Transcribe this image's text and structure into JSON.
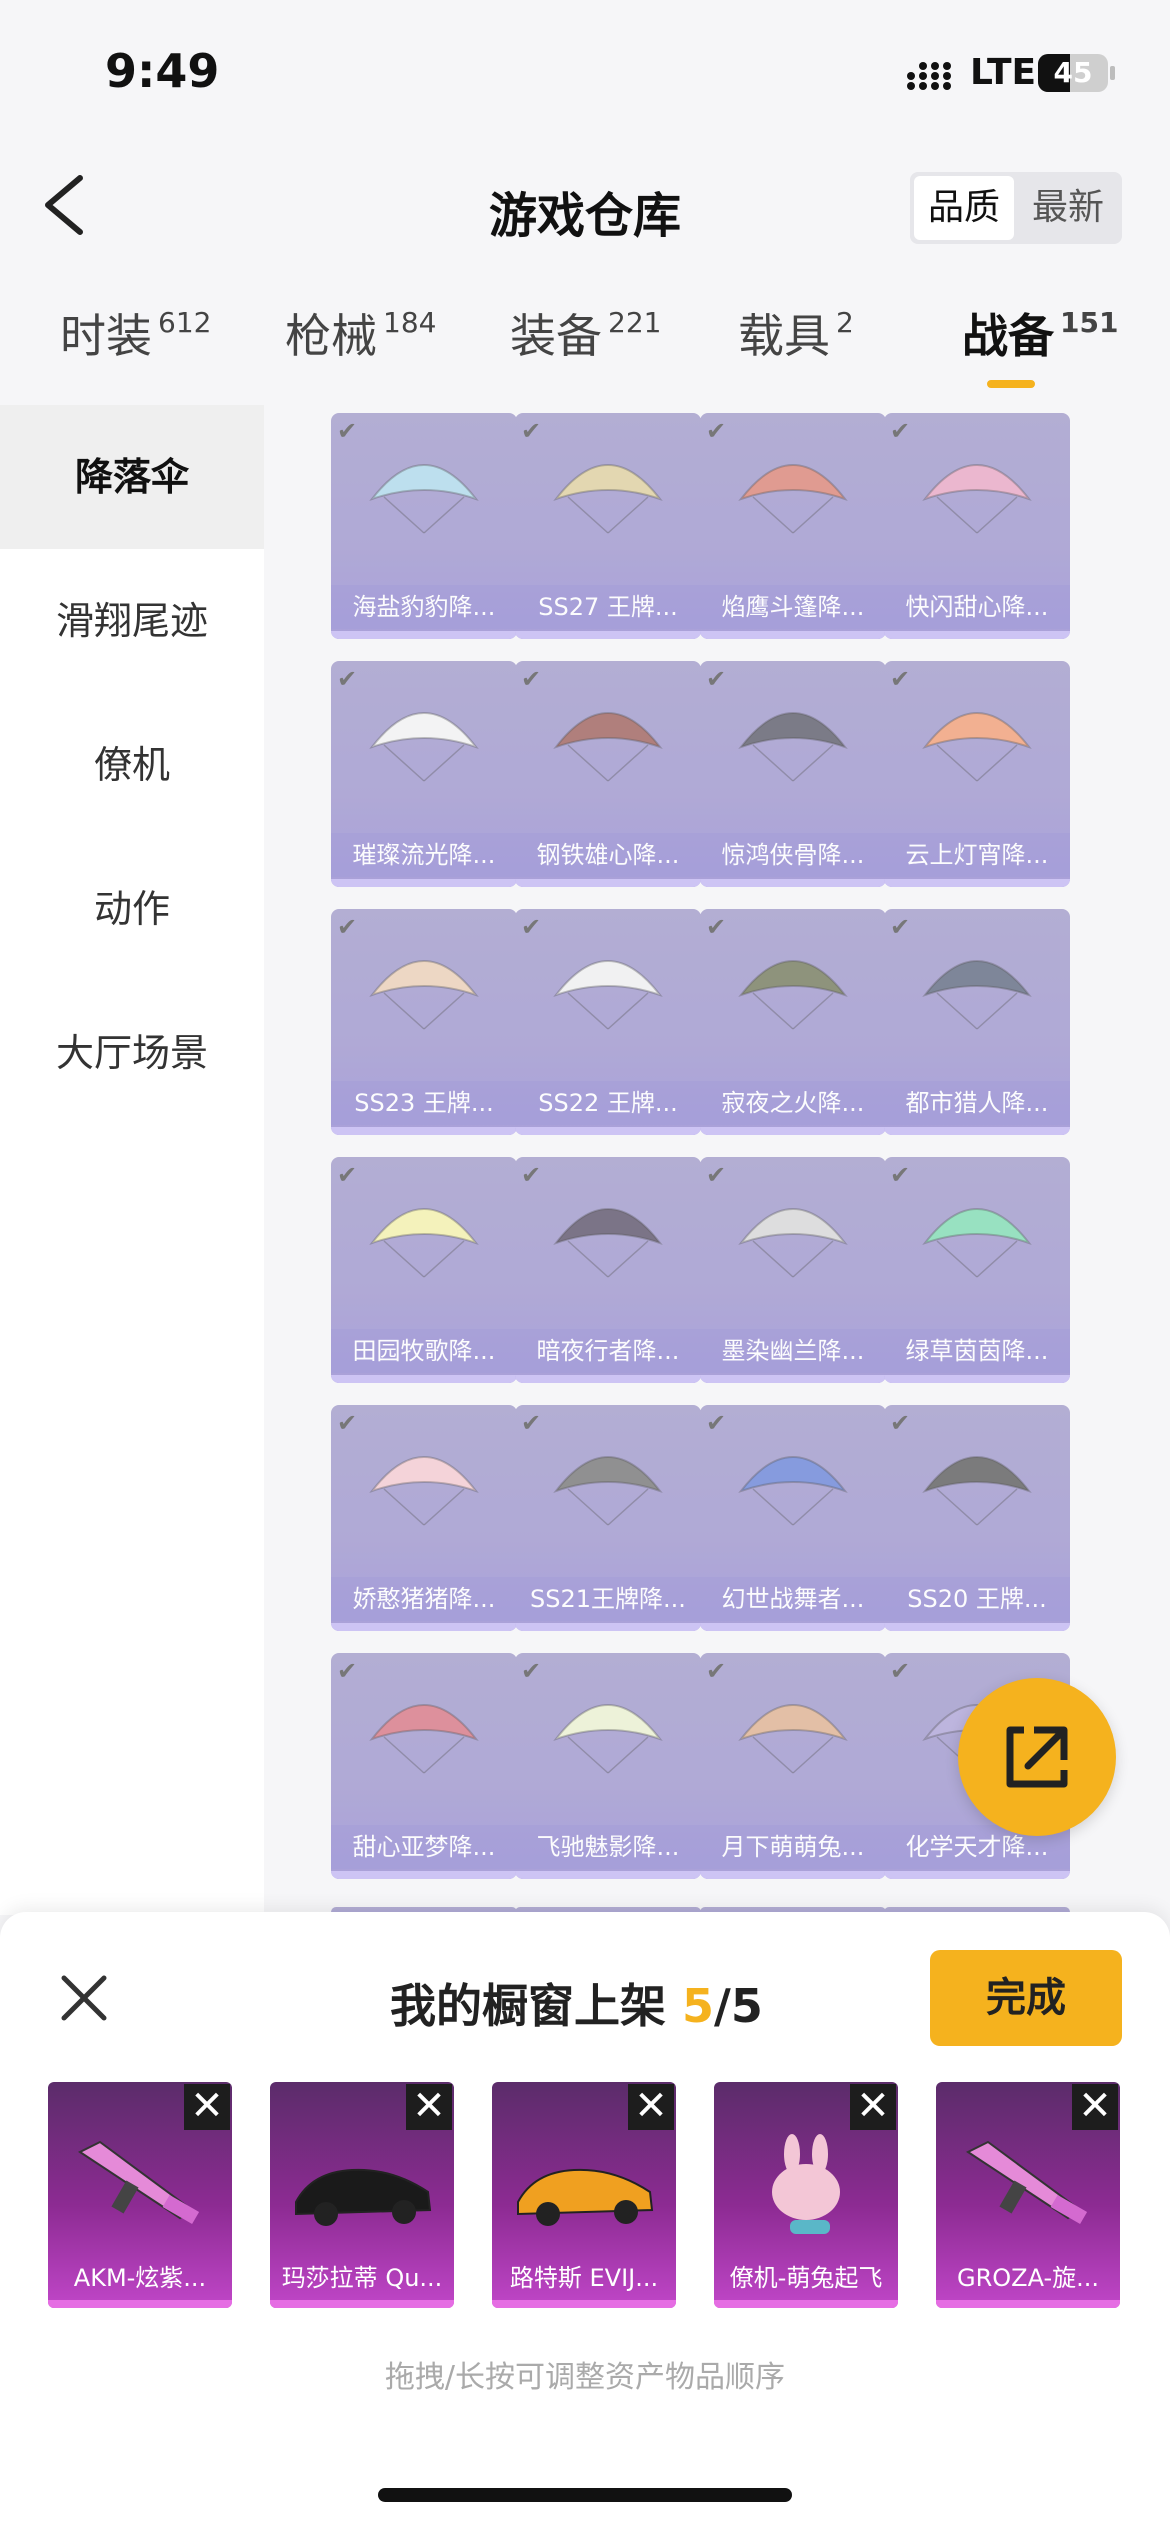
{
  "status_bar": {
    "time": "9:49",
    "network": "LTE",
    "battery": "45",
    "battery_level": 0.45
  },
  "header": {
    "title": "游戏仓库",
    "sort_options": [
      "品质",
      "最新"
    ],
    "sort_selected": "品质"
  },
  "tabs": [
    {
      "label": "时装",
      "count": "612"
    },
    {
      "label": "枪械",
      "count": "184"
    },
    {
      "label": "装备",
      "count": "221"
    },
    {
      "label": "载具",
      "count": "2"
    },
    {
      "label": "战备",
      "count": "151",
      "active": true
    }
  ],
  "sidebar": {
    "items": [
      "降落伞",
      "滑翔尾迹",
      "僚机",
      "动作",
      "大厅场景"
    ],
    "active": "降落伞"
  },
  "grid_items": [
    {
      "label": "海盐豹豹降...",
      "color": "#9fd3e8"
    },
    {
      "label": "SS27 王牌...",
      "color": "#d9c78a"
    },
    {
      "label": "焰鹰斗篷降...",
      "color": "#d46a5a"
    },
    {
      "label": "快闪甜心降...",
      "color": "#e596b8"
    },
    {
      "label": "璀璨流光降...",
      "color": "#f1f1f1"
    },
    {
      "label": "钢铁雄心降...",
      "color": "#8a3f3a"
    },
    {
      "label": "惊鸿侠骨降...",
      "color": "#3a3a4a"
    },
    {
      "label": "云上灯宵降...",
      "color": "#f08a5a"
    },
    {
      "label": "SS23 王牌...",
      "color": "#e8c6a8"
    },
    {
      "label": "SS22 王牌...",
      "color": "#eeeeee"
    },
    {
      "label": "寂夜之火降...",
      "color": "#565e3a"
    },
    {
      "label": "都市猎人降...",
      "color": "#3e4a66"
    },
    {
      "label": "田园牧歌降...",
      "color": "#f3f09a"
    },
    {
      "label": "暗夜行者降...",
      "color": "#3a2f4a"
    },
    {
      "label": "墨染幽兰降...",
      "color": "#d0d0d0"
    },
    {
      "label": "绿草茵茵降...",
      "color": "#66d6a4"
    },
    {
      "label": "娇憨猪猪降...",
      "color": "#f3c0c8"
    },
    {
      "label": "SS21王牌降...",
      "color": "#595959"
    },
    {
      "label": "幻世战舞者...",
      "color": "#4a6ad0"
    },
    {
      "label": "SS20 王牌...",
      "color": "#3a3a3a"
    },
    {
      "label": "甜心亚梦降...",
      "color": "#d05a6a"
    },
    {
      "label": "飞驰魅影降...",
      "color": "#e8f0c8"
    },
    {
      "label": "月下萌萌兔...",
      "color": "#d9a27a"
    },
    {
      "label": "化学天才降...",
      "color": "#9f93d0"
    }
  ],
  "showcase": {
    "title": "我的橱窗上架",
    "count": "5",
    "total": "/5",
    "done_label": "完成",
    "slots": [
      {
        "label": "AKM-炫紫...",
        "icon": "rifle-icon"
      },
      {
        "label": "玛莎拉蒂 Qu...",
        "icon": "car-icon"
      },
      {
        "label": "路特斯 EVIJ...",
        "icon": "car-icon"
      },
      {
        "label": "僚机-萌兔起飞",
        "icon": "bunny-icon"
      },
      {
        "label": "GROZA-旋...",
        "icon": "rifle-icon"
      }
    ],
    "hint": "拖拽/长按可调整资产物品顺序"
  },
  "colors": {
    "accent": "#f5b21e",
    "card": "#8a80c4",
    "slot": "#8d2b93"
  }
}
